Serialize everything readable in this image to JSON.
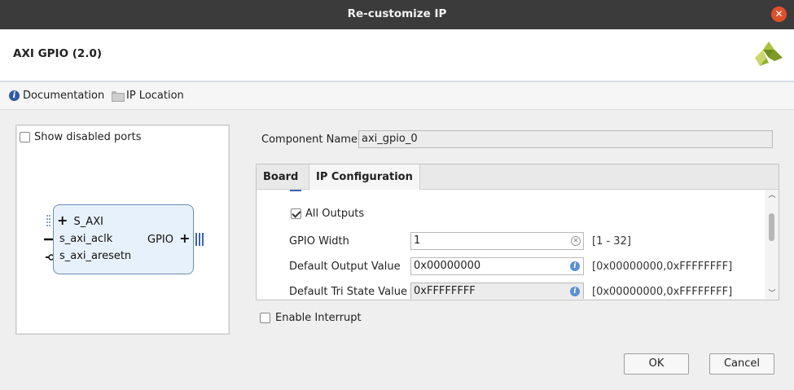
{
  "window": {
    "title": "Re-customize IP"
  },
  "header": {
    "ip_name": "AXI GPIO (2.0)"
  },
  "links": {
    "documentation": "Documentation",
    "ip_location": "IP Location"
  },
  "symbol_panel": {
    "show_disabled_ports": {
      "label": "Show disabled ports",
      "checked": false
    },
    "block": {
      "ports_left": [
        "S_AXI",
        "s_axi_aclk",
        "s_axi_aresetn"
      ],
      "port_right": "GPIO"
    }
  },
  "component_name": {
    "label": "Component Name",
    "value": "axi_gpio_0"
  },
  "tabs": [
    {
      "label": "Board",
      "active": false
    },
    {
      "label": "IP Configuration",
      "active": true
    }
  ],
  "ip_config": {
    "all_outputs": {
      "label": "All Outputs",
      "checked": true
    },
    "gpio_width": {
      "label": "GPIO Width",
      "value": "1",
      "range": "[1 - 32]"
    },
    "default_output_value": {
      "label": "Default Output Value",
      "value": "0x00000000",
      "range": "[0x00000000,0xFFFFFFFF]"
    },
    "default_tri_state_value": {
      "label": "Default Tri State Value",
      "value": "0xFFFFFFFF",
      "range": "[0x00000000,0xFFFFFFFF]"
    }
  },
  "enable_interrupt": {
    "label": "Enable Interrupt",
    "checked": false
  },
  "buttons": {
    "ok": "OK",
    "cancel": "Cancel"
  },
  "colors": {
    "titlebar": "#3b3b3b",
    "close": "#e0502b",
    "block_fill": "#e7f1fb",
    "block_border": "#6b8db5",
    "info": "#2f5aa3"
  }
}
